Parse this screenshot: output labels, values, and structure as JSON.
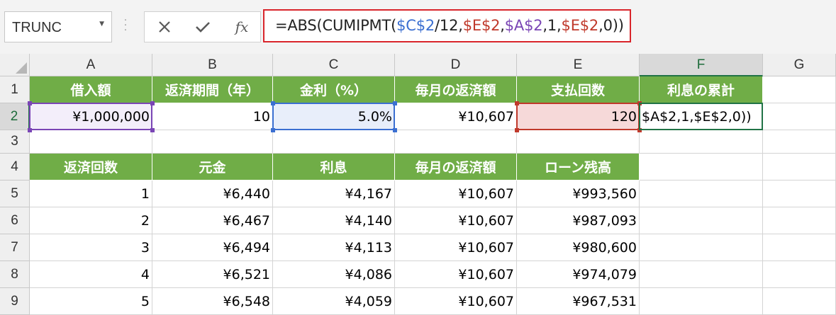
{
  "name_box": "TRUNC",
  "formula": {
    "segments": [
      {
        "text": "=ABS(CUMIPMT(",
        "cls": ""
      },
      {
        "text": "$C$2",
        "cls": "ref-blue"
      },
      {
        "text": "/12,",
        "cls": ""
      },
      {
        "text": "$E$2",
        "cls": "ref-red"
      },
      {
        "text": ",",
        "cls": ""
      },
      {
        "text": "$A$2",
        "cls": "ref-purple"
      },
      {
        "text": ",1,",
        "cls": ""
      },
      {
        "text": "$E$2",
        "cls": "ref-red"
      },
      {
        "text": ",0))",
        "cls": ""
      }
    ]
  },
  "columns": [
    "A",
    "B",
    "C",
    "D",
    "E",
    "F",
    "G"
  ],
  "rows": [
    "1",
    "2",
    "3",
    "4",
    "5",
    "6",
    "7",
    "8",
    "9"
  ],
  "row1_headers": [
    "借入額",
    "返済期間（年）",
    "金利（%）",
    "毎月の返済額",
    "支払回数",
    "利息の累計"
  ],
  "row2": {
    "loan": "¥1,000,000",
    "years": "10",
    "rate": "5.0%",
    "monthly": "¥10,607",
    "payments": "120",
    "edit_text": "$A$2,1,$E$2,0))"
  },
  "table_headers": [
    "返済回数",
    "元金",
    "利息",
    "毎月の返済額",
    "ローン残高"
  ],
  "table_rows": [
    [
      "1",
      "¥6,440",
      "¥4,167",
      "¥10,607",
      "¥993,560"
    ],
    [
      "2",
      "¥6,467",
      "¥4,140",
      "¥10,607",
      "¥987,093"
    ],
    [
      "3",
      "¥6,494",
      "¥4,113",
      "¥10,607",
      "¥980,600"
    ],
    [
      "4",
      "¥6,521",
      "¥4,086",
      "¥10,607",
      "¥974,079"
    ],
    [
      "5",
      "¥6,548",
      "¥4,059",
      "¥10,607",
      "¥967,531"
    ]
  ],
  "colors": {
    "header_green": "#70ad47",
    "accent_green": "#217346",
    "formula_border": "#d9252b",
    "range_blue": "#3b6fd1",
    "range_red": "#c0392b",
    "range_purple": "#7a45b5"
  }
}
